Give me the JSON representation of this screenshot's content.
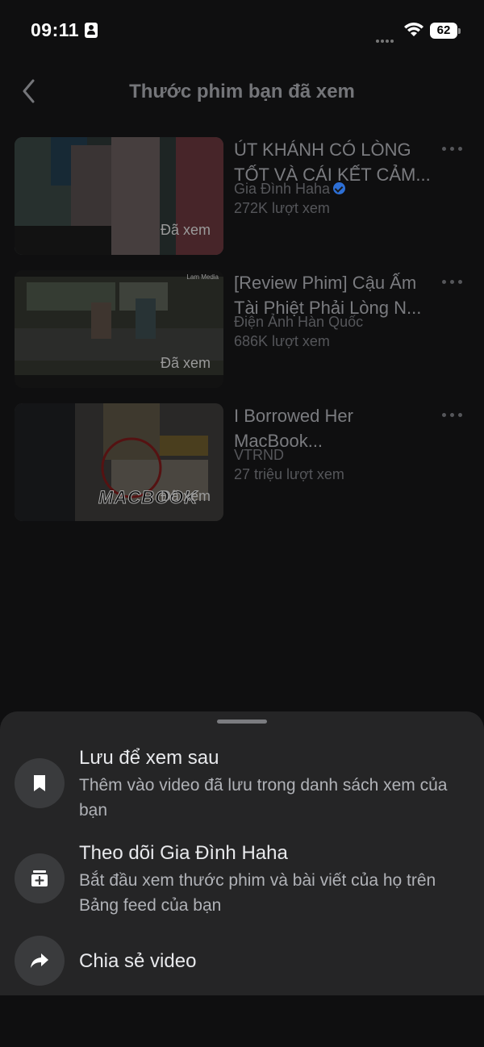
{
  "status_bar": {
    "time": "09:11",
    "battery": "62",
    "icons": [
      "person-badge-icon",
      "signal-dots-icon",
      "wifi-icon",
      "battery-icon"
    ]
  },
  "header": {
    "title": "Thước phim bạn đã xem",
    "back_icon": "chevron-left-icon"
  },
  "videos": [
    {
      "title": "ÚT KHÁNH CÓ LÒNG TỐT VÀ CÁI KẾT CẢM...",
      "channel": "Gia Đình Haha",
      "verified": true,
      "views": "272K lượt xem",
      "watched_label": "Đã xem"
    },
    {
      "title": "[Review Phim] Cậu Ấm Tài Phiệt Phải Lòng N...",
      "channel": "Điện Ảnh Hàn Quốc",
      "verified": false,
      "views": "686K lượt xem",
      "watched_label": "Đã xem",
      "thumb_watermark": "Lam Media"
    },
    {
      "title": "I Borrowed Her MacBook...",
      "channel": "VTRND",
      "verified": false,
      "views": "27 triệu lượt xem",
      "watched_label": "Đã xem",
      "thumb_overlay_text": "MACBOOK"
    }
  ],
  "sheet": {
    "items": [
      {
        "title": "Lưu để xem sau",
        "subtitle": "Thêm vào video đã lưu trong danh sách xem của bạn",
        "icon": "bookmark-icon"
      },
      {
        "title": "Theo dõi Gia Đình Haha",
        "subtitle": "Bắt đầu xem thước phim và bài viết của họ trên Bảng feed của bạn",
        "icon": "follow-box-icon"
      },
      {
        "title": "Chia sẻ video",
        "subtitle": "",
        "icon": "share-arrow-icon"
      }
    ]
  },
  "colors": {
    "background": "#0f0f10",
    "sheet": "#252526",
    "verified": "#2d6fd6"
  }
}
